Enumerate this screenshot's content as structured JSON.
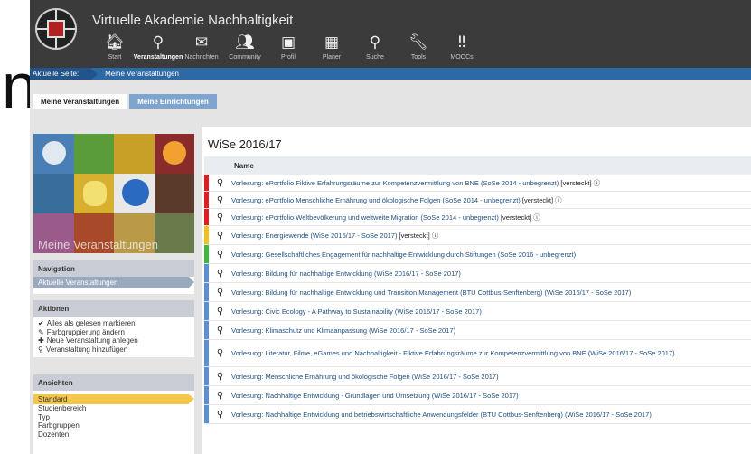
{
  "edge_fragment": "n",
  "header": {
    "title": "Virtuelle Akademie Nachhaltigkeit",
    "nav": [
      {
        "label": "Start",
        "icon": "home-icon",
        "glyph": "🏠︎",
        "active": false
      },
      {
        "label": "Veranstaltungen",
        "icon": "course-icon",
        "glyph": "⚲",
        "active": true
      },
      {
        "label": "Nachrichten",
        "icon": "mail-icon",
        "glyph": "✉",
        "active": false
      },
      {
        "label": "Community",
        "icon": "community-icon",
        "glyph": "👥︎",
        "active": false
      },
      {
        "label": "Profil",
        "icon": "profile-icon",
        "glyph": "▣",
        "active": false
      },
      {
        "label": "Planer",
        "icon": "calendar-icon",
        "glyph": "▦",
        "active": false
      },
      {
        "label": "Suche",
        "icon": "search-icon",
        "glyph": "⚲",
        "active": false
      },
      {
        "label": "Tools",
        "icon": "wrench-icon",
        "glyph": "🔧︎",
        "active": false
      },
      {
        "label": "MOOCs",
        "icon": "moocs-icon",
        "glyph": "‼",
        "active": false
      }
    ]
  },
  "breadcrumb": {
    "label": "Aktuelle Seite:",
    "current": "Meine Veranstaltungen"
  },
  "tabs": [
    {
      "label": "Meine Veranstaltungen",
      "active": true
    },
    {
      "label": "Meine Einrichtungen",
      "active": false
    }
  ],
  "sidebar": {
    "image_caption": "Meine Veranstaltungen",
    "navigation": {
      "title": "Navigation",
      "items": [
        "Aktuelle Veranstaltungen"
      ]
    },
    "actions": {
      "title": "Aktionen",
      "items": [
        {
          "icon": "check-icon",
          "glyph": "✔",
          "label": "Alles als gelesen markieren"
        },
        {
          "icon": "color-group-icon",
          "glyph": "✎",
          "label": "Farbgruppierung ändern"
        },
        {
          "icon": "new-course-icon",
          "glyph": "✚",
          "label": "Neue Veranstaltung anlegen"
        },
        {
          "icon": "add-course-icon",
          "glyph": "⚲",
          "label": "Veranstaltung hinzufügen"
        }
      ]
    },
    "views": {
      "title": "Ansichten",
      "items": [
        "Standard",
        "Studienbereich",
        "Typ",
        "Farbgruppen",
        "Dozenten"
      ],
      "selected": "Standard"
    }
  },
  "main": {
    "semester": "WiSe 2016/17",
    "column_name": "Name",
    "rows": [
      {
        "color": "#e02020",
        "text": "Vorlesung: ePortfolio Fiktive Erfahrungsräume zur Kompetenzvermittlung von BNE (SoSe 2014 - unbegrenzt)",
        "flag": "[versteckt] ⓘ"
      },
      {
        "color": "#e02020",
        "text": "Vorlesung: ePortfolio Menschliche Ernährung und ökologische Folgen (SoSe 2014 - unbegrenzt)",
        "flag": "[versteckt] ⓘ"
      },
      {
        "color": "#e02020",
        "text": "Vorlesung: ePortfolio Weltbevölkerung und weltweite Migration (SoSe 2014 - unbegrenzt)",
        "flag": "[versteckt] ⓘ"
      },
      {
        "color": "#f0c020",
        "text": "Vorlesung: Energiewende (WiSe 2016/17 - SoSe 2017)",
        "flag": "[versteckt] ⓘ"
      },
      {
        "color": "#3fb840",
        "text": "Vorlesung: Gesellschaftliches Engagement für nachhaltige Entwicklung durch Stiftungen (SoSe 2016 - unbegrenzt)",
        "flag": ""
      },
      {
        "color": "#5b8fd0",
        "text": "Vorlesung: Bildung für nachhaltige Entwicklung (WiSe 2016/17 - SoSe 2017)",
        "flag": ""
      },
      {
        "color": "#5b8fd0",
        "text": "Vorlesung: Bildung für nachhaltige Entwicklung und Transition Management (BTU Cottbus-Senftenberg) (WiSe 2016/17 - SoSe 2017)",
        "flag": ""
      },
      {
        "color": "#5b8fd0",
        "text": "Vorlesung: Civic Ecology - A Pathway to Sustainability (WiSe 2016/17 - SoSe 2017)",
        "flag": ""
      },
      {
        "color": "#5b8fd0",
        "text": "Vorlesung: Klimaschutz und Klimaanpassung (WiSe 2016/17 - SoSe 2017)",
        "flag": ""
      },
      {
        "color": "#5b8fd0",
        "text": "Vorlesung: Literatur, Filme, eGames und Nachhaltigkeit - Fiktive Erfahrungsräume zur Kompetenzvermittlung von BNE (WiSe 2016/17 - SoSe 2017)",
        "flag": ""
      },
      {
        "color": "#5b8fd0",
        "text": "Vorlesung: Menschliche Ernährung und ökologische Folgen (WiSe 2016/17 - SoSe 2017)",
        "flag": ""
      },
      {
        "color": "#5b8fd0",
        "text": "Vorlesung: Nachhaltige Entwicklung - Grundlagen und Umsetzung (WiSe 2016/17 - SoSe 2017)",
        "flag": ""
      },
      {
        "color": "#5b8fd0",
        "text": "Vorlesung: Nachhaltige Entwicklung und betriebswirtschaftliche Anwendungsfelder (BTU Cottbus-Senftenberg) (WiSe 2016/17 - SoSe 2017)",
        "flag": ""
      }
    ]
  }
}
